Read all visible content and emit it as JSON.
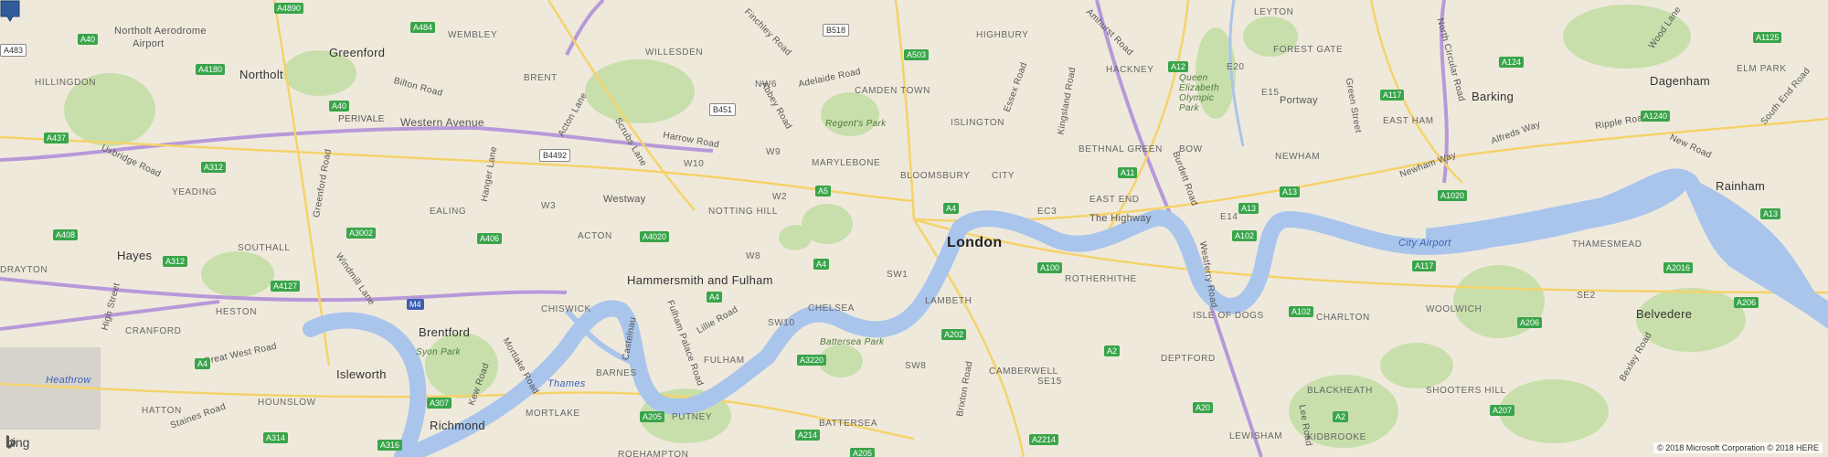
{
  "map": {
    "city_label": "London",
    "river_label": "Thames",
    "copyright": "© 2018 Microsoft Corporation © 2018 HERE",
    "brand": "bing",
    "colors": {
      "water": "#a9c5ec",
      "park": "#c8dfab",
      "land": "#efe9dc",
      "road": "#fce38a",
      "motorway": "#a480c8",
      "pin": "#2f5d9c"
    },
    "places": {
      "northolt_aerodrome": "Northolt Aerodrome",
      "airport": "Airport",
      "greenford": "Greenford",
      "northolt": "Northolt",
      "hillingdon": "HILLINGDON",
      "hayes": "Hayes",
      "southall": "SOUTHALL",
      "ealing": "EALING",
      "acton": "ACTON",
      "westway": "Westway",
      "notting_hill": "NOTTING HILL",
      "marylebone": "MARYLEBONE",
      "bloomsbury": "BLOOMSBURY",
      "camden_town": "CAMDEN TOWN",
      "islington": "ISLINGTON",
      "hackney": "HACKNEY",
      "bethnal_green": "BETHNAL GREEN",
      "bow": "BOW",
      "east_end": "EAST END",
      "city": "CITY",
      "the_highway": "The Highway",
      "rotherhithe": "ROTHERHITHE",
      "isle_of_dogs": "ISLE OF DOGS",
      "lambeth": "LAMBETH",
      "hammersmith_fulham": "Hammersmith and Fulham",
      "chiswick": "CHISWICK",
      "brentford": "Brentford",
      "isleworth": "Isleworth",
      "richmond": "Richmond",
      "mortlake": "MORTLAKE",
      "barnes": "BARNES",
      "fulham": "FULHAM",
      "chelsea": "CHELSEA",
      "putney": "PUTNEY",
      "battersea": "BATTERSEA",
      "camberwell": "CAMBERWELL",
      "deptford": "DEPTFORD",
      "blackheath": "BLACKHEATH",
      "charlton": "CHARLTON",
      "woolwich": "WOOLWICH",
      "newham": "NEWHAM",
      "barking": "Barking",
      "dagenham": "Dagenham",
      "rainham": "Rainham",
      "belvedere": "Belvedere",
      "thamesmead": "THAMESMEAD",
      "city_airport": "City Airport",
      "shooters_hill": "SHOOTERS HILL",
      "east_ham": "EAST HAM",
      "forest_gate": "FOREST GATE",
      "leyton": "LEYTON",
      "portway": "Portway",
      "heathrow": "Heathrow",
      "hounslow": "HOUNSLOW",
      "heston": "HESTON",
      "cranford": "CRANFORD",
      "hatton": "HATTON",
      "yeading": "YEADING",
      "willesden": "WILLESDEN",
      "kilburn": "NW6",
      "wembley": "WEMBLEY",
      "brent": "BRENT",
      "highbury": "HIGHBURY",
      "queen_elizabeth_park": "Queen Elizabeth Olympic Park",
      "regents_park": "Regent's Park",
      "battersea_park": "Battersea Park",
      "syon_park": "Syon Park",
      "lewisham": "LEWISHAM",
      "kidbrooke": "KIDBROOKE",
      "se15": "SE15",
      "sw8": "SW8",
      "sw1": "SW1",
      "sw10": "SW10",
      "w8": "W8",
      "w2": "W2",
      "w3": "W3",
      "w9": "W9",
      "w10": "W10",
      "ec3": "EC3",
      "e14": "E14",
      "e15": "E15",
      "e20": "E20",
      "se2": "SE2",
      "roehampton": "ROEHAMPTON",
      "elm_park": "ELM PARK",
      "drayton": "DRAYTON"
    },
    "roads": {
      "western_avenue": "Western Avenue",
      "perivale": "PERIVALE",
      "uxbridge_road": "Uxbridge Road",
      "great_west_road": "Great West Road",
      "harrow_road": "Harrow Road",
      "finchley_road": "Finchley Road",
      "adelaide_road": "Adelaide Road",
      "kingsland_road": "Kingsland Road",
      "essex_road": "Essex Road",
      "newham_way": "Newham Way",
      "alfreds_way": "Alfreds Way",
      "ripple_road": "Ripple Road",
      "new_road": "New Road",
      "brixton_road": "Brixton Road",
      "staines_road": "Staines Road",
      "hanger_lane": "Hanger Lane",
      "windmill_lane": "Windmill Lane",
      "fulham_palace_road": "Fulham Palace Road",
      "lillie_road": "Lillie Road",
      "green_street": "Green Street",
      "north_circular": "North Circular Road",
      "wood_lane": "Wood Lane",
      "bilton_road": "Bilton Road",
      "greenford_road": "Greenford Road",
      "acton_lane": "Acton Lane",
      "scrubs_lane": "Scrubs Lane",
      "abbey_road": "Abbey Road",
      "burdett_road": "Burdett Road",
      "westferry_road": "Westferry Road",
      "kew_road": "Kew Road",
      "mortlake_road": "Mortlake Road",
      "high_street": "High Street",
      "castelnau": "Castelnau",
      "amhurst_road": "Amhurst Road",
      "lee_road": "Lee Road",
      "bexley_road": "Bexley Road",
      "south_end_road": "South End Road"
    },
    "shields": {
      "m4": "M4",
      "a40": "A40",
      "a4180": "A4180",
      "a437": "A437",
      "a312": "A312",
      "a408": "A408",
      "a4127": "A4127",
      "a4": "A4",
      "a3002": "A3002",
      "a4020": "A4020",
      "a406": "A406",
      "a5": "A5",
      "a503": "A503",
      "a4890": "A4890",
      "a484": "A484",
      "b518": "B518",
      "b451": "B451",
      "b4492": "B4492",
      "a3220": "A3220",
      "a205": "A205",
      "a214": "A214",
      "a307": "A307",
      "a316": "A316",
      "a314": "A314",
      "a202": "A202",
      "a100": "A100",
      "a2": "A2",
      "a20": "A20",
      "a2214": "A2214",
      "a11": "A11",
      "a13": "A13",
      "a12": "A12",
      "a102": "A102",
      "a1020": "A1020",
      "a117": "A117",
      "a124": "A124",
      "a1240": "A1240",
      "a1125": "A1125",
      "a206": "A206",
      "a207": "A207",
      "a2016": "A2016",
      "a483": "A483"
    }
  }
}
